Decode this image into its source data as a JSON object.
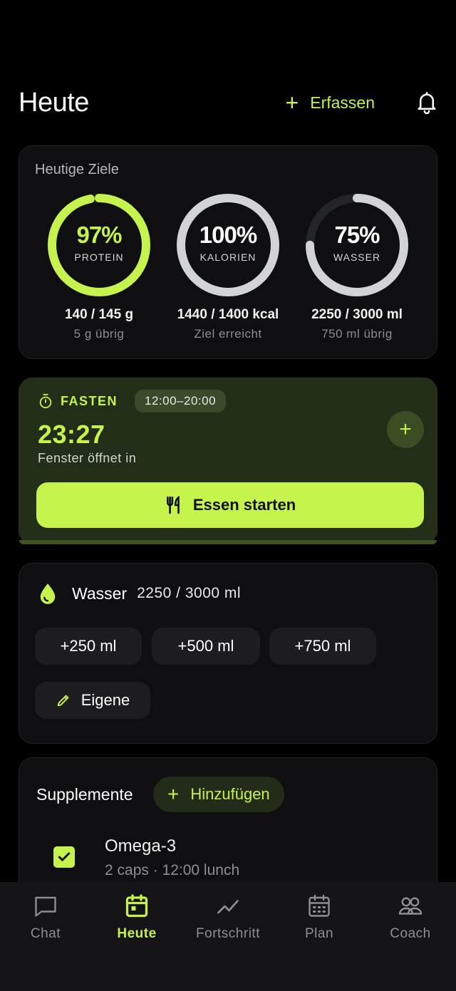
{
  "header": {
    "title": "Heute",
    "add_label": "Erfassen"
  },
  "goals": {
    "title": "Heutige Ziele",
    "rings": [
      {
        "pct_label": "97%",
        "progress": 0.97,
        "label": "PROTEIN",
        "value": "140 / 145 g",
        "sub": "5 g übrig",
        "color": "#c6f24e",
        "pct_color": "#c6f24e"
      },
      {
        "pct_label": "100%",
        "progress": 1.0,
        "label": "KALORIEN",
        "value": "1440 / 1400 kcal",
        "sub": "Ziel erreicht",
        "color": "#d1d3d6",
        "pct_color": "#ffffff"
      },
      {
        "pct_label": "75%",
        "progress": 0.75,
        "label": "WASSER",
        "value": "2250 / 3000 ml",
        "sub": "750 ml übrig",
        "color": "#d1d3d6",
        "pct_color": "#ffffff"
      }
    ]
  },
  "fasting": {
    "label": "FASTEN",
    "window": "12:00–20:00",
    "countdown": "23:27",
    "sub": "Fenster öffnet in",
    "start_label": "Essen starten"
  },
  "water": {
    "title": "Wasser",
    "value": "2250 / 3000 ml",
    "chips": [
      "+250 ml",
      "+500 ml",
      "+750 ml"
    ],
    "custom_label": "Eigene"
  },
  "supplements": {
    "title": "Supplemente",
    "add_label": "Hinzufügen",
    "items": [
      {
        "name": "Omega-3",
        "detail": "2 caps · 12:00 lunch",
        "checked": true
      }
    ]
  },
  "tabs": [
    {
      "label": "Chat",
      "icon": "chat-icon",
      "active": false
    },
    {
      "label": "Heute",
      "icon": "calendar-today-icon",
      "active": true
    },
    {
      "label": "Fortschritt",
      "icon": "trend-icon",
      "active": false
    },
    {
      "label": "Plan",
      "icon": "calendar-grid-icon",
      "active": false
    },
    {
      "label": "Coach",
      "icon": "people-icon",
      "active": false
    }
  ],
  "colors": {
    "accent": "#c6f24e",
    "background": "#000000",
    "card": "#0f0f11",
    "fasting_card": "#232e18"
  }
}
